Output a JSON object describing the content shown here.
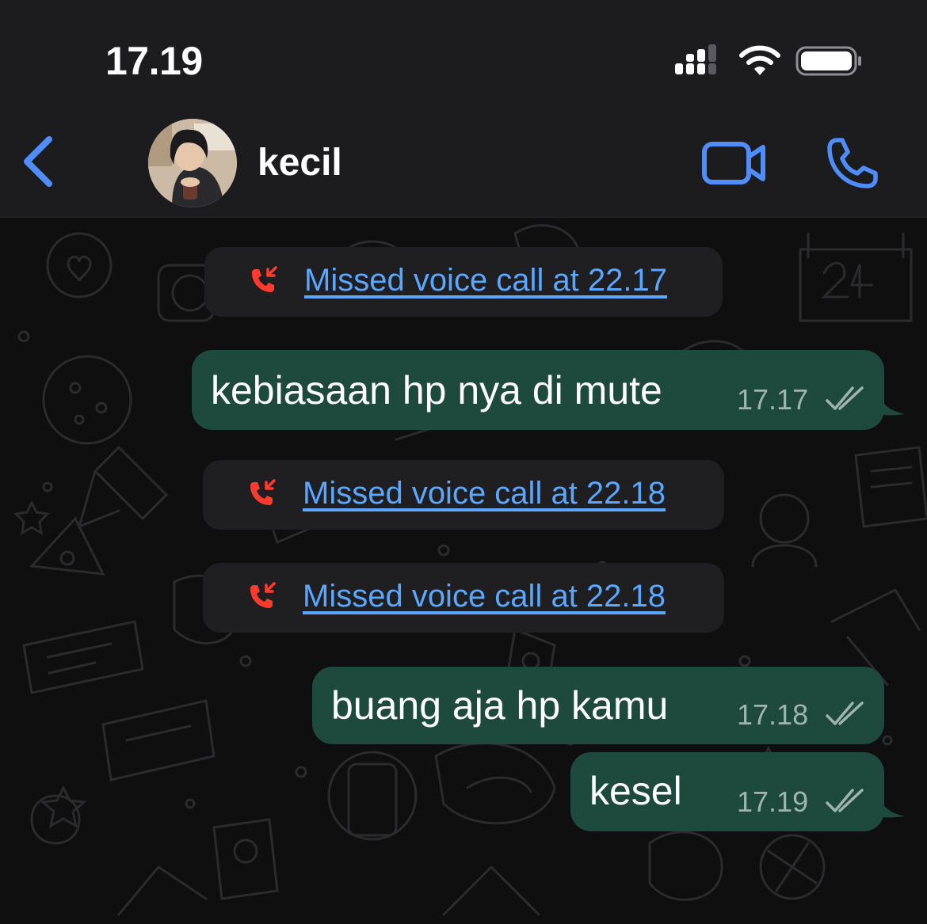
{
  "status_bar": {
    "time": "17.19",
    "icons": [
      "cellular-signal-icon",
      "wifi-icon",
      "battery-icon"
    ]
  },
  "header": {
    "contact_name": "kecil",
    "icons": [
      "back-chevron-icon",
      "video-call-icon",
      "voice-call-icon"
    ]
  },
  "colors": {
    "accent": "#4f8dfb",
    "missed_call_red": "#ff3b30",
    "link_blue": "#5aa7ff",
    "outgoing_bubble": "#1e4a3d"
  },
  "messages": [
    {
      "type": "missed_call",
      "text": "Missed voice call at 22.17",
      "icon": "missed-call-icon"
    },
    {
      "type": "outgoing",
      "text": "kebiasaan hp nya di mute",
      "time": "17.17",
      "status": "read"
    },
    {
      "type": "missed_call",
      "text": "Missed voice call at 22.18",
      "icon": "missed-call-icon"
    },
    {
      "type": "missed_call",
      "text": "Missed voice call at 22.18",
      "icon": "missed-call-icon"
    },
    {
      "type": "outgoing",
      "text": "buang aja hp kamu",
      "time": "17.18",
      "status": "read"
    },
    {
      "type": "outgoing",
      "text": "kesel",
      "time": "17.19",
      "status": "read"
    }
  ]
}
